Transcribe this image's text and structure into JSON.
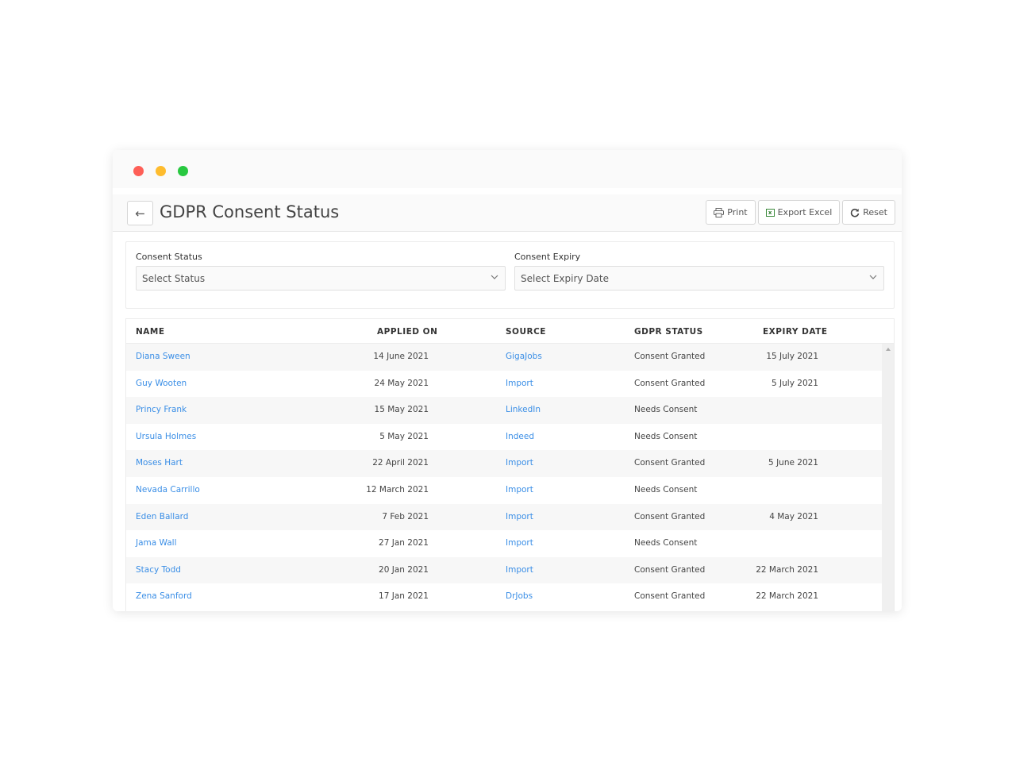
{
  "header": {
    "title": "GDPR Consent Status",
    "back_icon": "arrow-left-icon"
  },
  "toolbar": {
    "print_label": "Print",
    "export_label": "Export Excel",
    "reset_label": "Reset"
  },
  "filters": {
    "consent_status": {
      "label": "Consent Status",
      "placeholder": "Select Status"
    },
    "consent_expiry": {
      "label": "Consent Expiry",
      "placeholder": "Select Expiry Date"
    }
  },
  "table": {
    "columns": [
      "NAME",
      "APPLIED ON",
      "SOURCE",
      "GDPR STATUS",
      "EXPIRY DATE"
    ],
    "rows": [
      {
        "name": "Diana Sween",
        "applied": "14 June 2021",
        "source": "GigaJobs",
        "status": "Consent Granted",
        "expiry": "15 July 2021"
      },
      {
        "name": "Guy Wooten",
        "applied": "24 May 2021",
        "source": "Import",
        "status": "Consent Granted",
        "expiry": "5 July 2021"
      },
      {
        "name": "Princy Frank",
        "applied": "15 May 2021",
        "source": "LinkedIn",
        "status": "Needs Consent",
        "expiry": ""
      },
      {
        "name": "Ursula Holmes",
        "applied": "5 May 2021",
        "source": "Indeed",
        "status": "Needs Consent",
        "expiry": ""
      },
      {
        "name": "Moses Hart",
        "applied": "22 April 2021",
        "source": "Import",
        "status": "Consent Granted",
        "expiry": "5 June 2021"
      },
      {
        "name": "Nevada Carrillo",
        "applied": "12 March 2021",
        "source": "Import",
        "status": "Needs Consent",
        "expiry": ""
      },
      {
        "name": "Eden Ballard",
        "applied": "7 Feb 2021",
        "source": "Import",
        "status": "Consent Granted",
        "expiry": "4 May 2021"
      },
      {
        "name": "Jama Wall",
        "applied": "27 Jan 2021",
        "source": "Import",
        "status": "Needs Consent",
        "expiry": ""
      },
      {
        "name": "Stacy Todd",
        "applied": "20 Jan 2021",
        "source": "Import",
        "status": "Consent Granted",
        "expiry": "22 March 2021"
      },
      {
        "name": "Zena Sanford",
        "applied": "17 Jan 2021",
        "source": "DrJobs",
        "status": "Consent Granted",
        "expiry": "22 March 2021"
      }
    ]
  },
  "colors": {
    "link": "#3a8ee6",
    "close": "#fe5f57",
    "minimize": "#febc2e",
    "maximize": "#28c840"
  }
}
